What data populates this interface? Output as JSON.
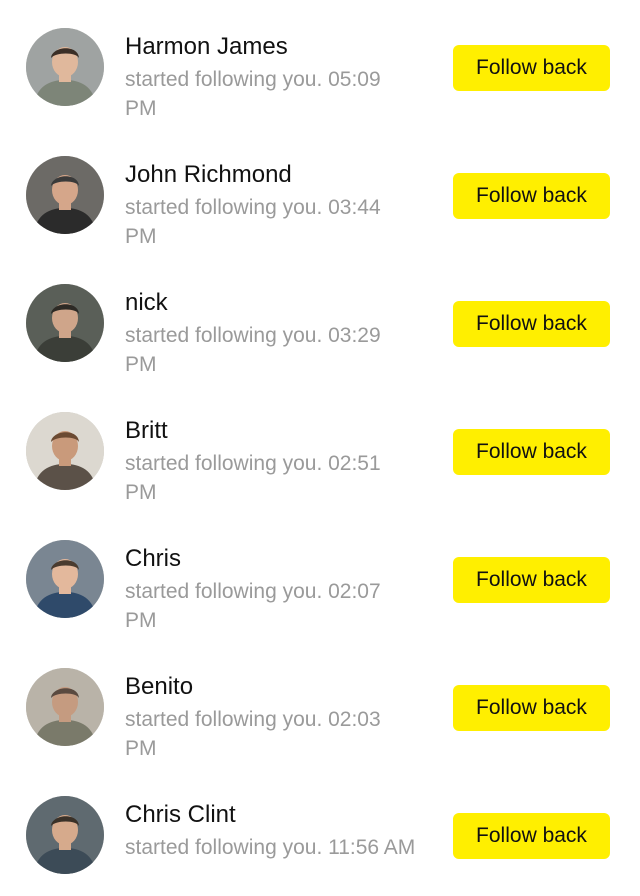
{
  "notifications": [
    {
      "name": "Harmon James",
      "activity": "started following you. 05:09 PM",
      "button_label": "Follow back",
      "avatar": {
        "skin": "#e0b89c",
        "hair": "#3b2f27",
        "clothes": "#7d8578",
        "bg": "#9fa3a2"
      }
    },
    {
      "name": "John Richmond",
      "activity": "started following you. 03:44 PM",
      "button_label": "Follow back",
      "avatar": {
        "skin": "#d5a68a",
        "hair": "#3a3a3a",
        "clothes": "#2b2b2b",
        "bg": "#6c6a66"
      }
    },
    {
      "name": "nick",
      "activity": "started following you. 03:29 PM",
      "button_label": "Follow back",
      "avatar": {
        "skin": "#cfa58a",
        "hair": "#2d2a25",
        "clothes": "#3b3e38",
        "bg": "#5a5f58"
      }
    },
    {
      "name": "Britt",
      "activity": "started following you. 02:51 PM",
      "button_label": "Follow back",
      "avatar": {
        "skin": "#c99a7b",
        "hair": "#6b4a32",
        "clothes": "#5b5148",
        "bg": "#dcd8d0"
      }
    },
    {
      "name": "Chris",
      "activity": "started following you. 02:07 PM",
      "button_label": "Follow back",
      "avatar": {
        "skin": "#e3b89c",
        "hair": "#4a3b2f",
        "clothes": "#2f4a6a",
        "bg": "#7a8692"
      }
    },
    {
      "name": "Benito",
      "activity": "started following you. 02:03 PM",
      "button_label": "Follow back",
      "avatar": {
        "skin": "#c59b80",
        "hair": "#5a4a40",
        "clothes": "#7a7a6a",
        "bg": "#b9b3a8"
      }
    },
    {
      "name": "Chris Clint",
      "activity": "started following you. 11:56 AM",
      "button_label": "Follow back",
      "avatar": {
        "skin": "#d6aa8c",
        "hair": "#3a3128",
        "clothes": "#3c4b57",
        "bg": "#5f6a70"
      }
    }
  ]
}
